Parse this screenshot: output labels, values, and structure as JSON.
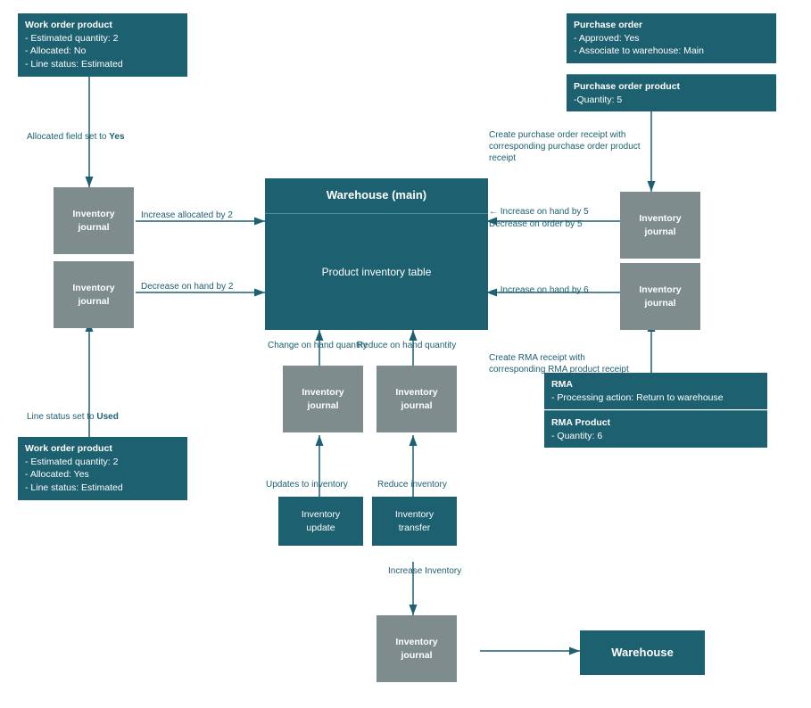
{
  "boxes": {
    "work_order_top": {
      "label": "Work order product",
      "lines": [
        "- Estimated quantity: 2",
        "- Allocated: No",
        "- Line status: Estimated"
      ]
    },
    "work_order_bottom": {
      "label": "Work order product",
      "lines": [
        "- Estimated quantity: 2",
        "- Allocated: Yes",
        "- Line status: Estimated"
      ]
    },
    "purchase_order": {
      "label": "Purchase order",
      "lines": [
        "- Approved: Yes",
        "- Associate to warehouse: Main"
      ]
    },
    "purchase_order_product": {
      "label": "Purchase order product",
      "lines": [
        "-Quantity: 5"
      ]
    },
    "warehouse_main": {
      "label": "Warehouse (main)"
    },
    "product_inventory_table": {
      "label": "Product inventory table"
    },
    "inv_journal_1": {
      "label": "Inventory\njournal"
    },
    "inv_journal_2": {
      "label": "Inventory\njournal"
    },
    "inv_journal_3": {
      "label": "Inventory\njournal"
    },
    "inv_journal_4": {
      "label": "Inventory\njournal"
    },
    "inv_journal_5": {
      "label": "Inventory\njournal"
    },
    "inv_journal_6": {
      "label": "Inventory\njournal"
    },
    "inv_journal_7": {
      "label": "Inventory\njournal"
    },
    "inv_update": {
      "label": "Inventory\nupdate"
    },
    "inv_transfer": {
      "label": "Inventory\ntransfer"
    },
    "rma": {
      "label": "RMA",
      "lines": [
        "- Processing action: Return to warehouse"
      ]
    },
    "rma_product": {
      "label": "RMA Product",
      "lines": [
        "- Quantity: 6"
      ]
    },
    "warehouse_bottom": {
      "label": "Warehouse"
    }
  },
  "labels": {
    "allocated_yes": "Allocated field set to ",
    "allocated_yes_bold": "Yes",
    "line_status_used": "Line status set to ",
    "line_status_used_bold": "Used",
    "increase_allocated": "Increase allocated by 2",
    "decrease_on_hand": "Decrease on hand by 2",
    "increase_on_hand_5": "Increase on hand by 5",
    "decrease_on_order_5": "Decrease on order by 5",
    "increase_on_hand_6": "Increase on hand by 6",
    "change_on_hand": "Change on hand quantity",
    "reduce_on_hand": "Reduce on hand quantity",
    "updates_to_inventory": "Updates to inventory",
    "reduce_inventory": "Reduce inventory",
    "increase_inventory": "Increase Inventory",
    "create_po_receipt": "Create purchase order receipt with\ncorresponding purchase order product receipt",
    "create_rma_receipt": "Create RMA receipt with\ncorresponding RMA product receipt"
  }
}
